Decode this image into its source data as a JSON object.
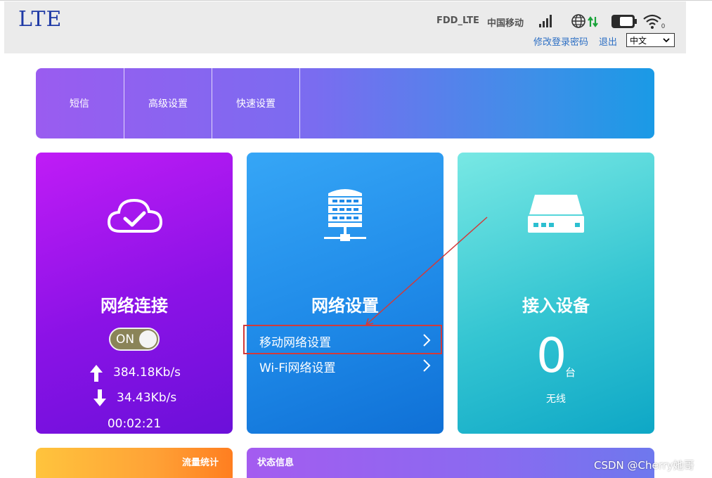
{
  "header": {
    "logo": "LTE",
    "network_type": "FDD_LTE",
    "carrier": "中国移动",
    "change_password_link": "修改登录密码",
    "logout_link": "退出",
    "language": {
      "selected": "中文"
    }
  },
  "nav": {
    "tabs": [
      {
        "label": "短信"
      },
      {
        "label": "高级设置"
      },
      {
        "label": "快速设置"
      }
    ]
  },
  "cards": {
    "network": {
      "title": "网络连接",
      "toggle_label": "ON",
      "upload_speed": "384.18Kb/s",
      "download_speed": "34.43Kb/s",
      "uptime": "00:02:21"
    },
    "settings": {
      "title": "网络设置",
      "links": [
        {
          "label": "移动网络设置"
        },
        {
          "label": "Wi-Fi网络设置"
        }
      ]
    },
    "devices": {
      "title": "接入设备",
      "count": "0",
      "unit": "台",
      "connection_type": "无线"
    }
  },
  "bottom": {
    "traffic_title": "流量统计",
    "status_title": "状态信息"
  },
  "watermark": "CSDN @Cherry她哥",
  "colors": {
    "annotation_red": "#d23a3a",
    "link_blue": "#2d6fc4",
    "logo_blue": "#1f3aa6"
  }
}
